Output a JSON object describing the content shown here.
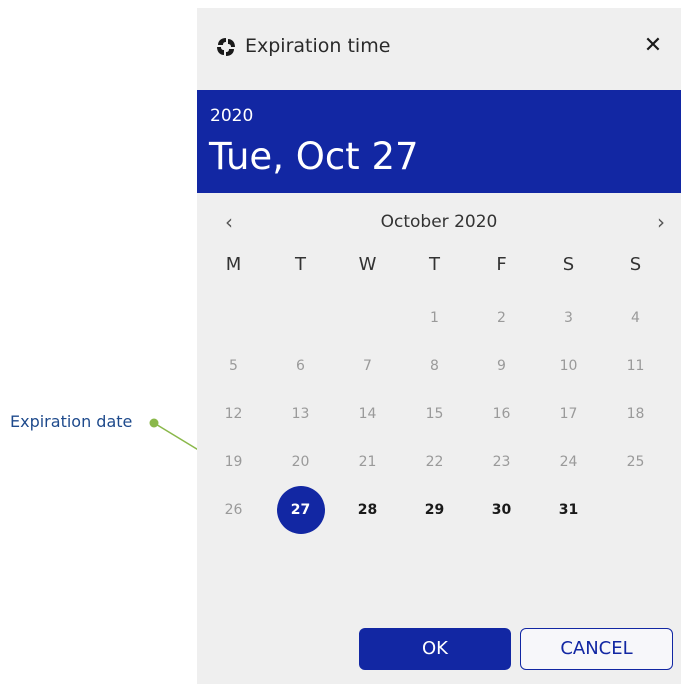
{
  "callout": {
    "label": "Expiration date"
  },
  "dialog": {
    "title": "Expiration time",
    "close_icon": "close-icon",
    "app_icon": "app-logo-icon",
    "header": {
      "year": "2020",
      "date": "Tue, Oct 27"
    },
    "calendar": {
      "month_label": "October 2020",
      "prev_icon": "chevron-left-icon",
      "next_icon": "chevron-right-icon",
      "weekdays": [
        "M",
        "T",
        "W",
        "T",
        "F",
        "S",
        "S"
      ],
      "weeks": [
        [
          "",
          "",
          "",
          "1",
          "2",
          "3",
          "4"
        ],
        [
          "5",
          "6",
          "7",
          "8",
          "9",
          "10",
          "11"
        ],
        [
          "12",
          "13",
          "14",
          "15",
          "16",
          "17",
          "18"
        ],
        [
          "19",
          "20",
          "21",
          "22",
          "23",
          "24",
          "25"
        ],
        [
          "26",
          "27",
          "28",
          "29",
          "30",
          "31",
          ""
        ]
      ],
      "selected_day": "27",
      "enabled_days": [
        "27",
        "28",
        "29",
        "30",
        "31"
      ]
    },
    "buttons": {
      "ok": "OK",
      "cancel": "CANCEL"
    },
    "colors": {
      "accent": "#1227a3",
      "callout": "#8ab84a"
    }
  }
}
